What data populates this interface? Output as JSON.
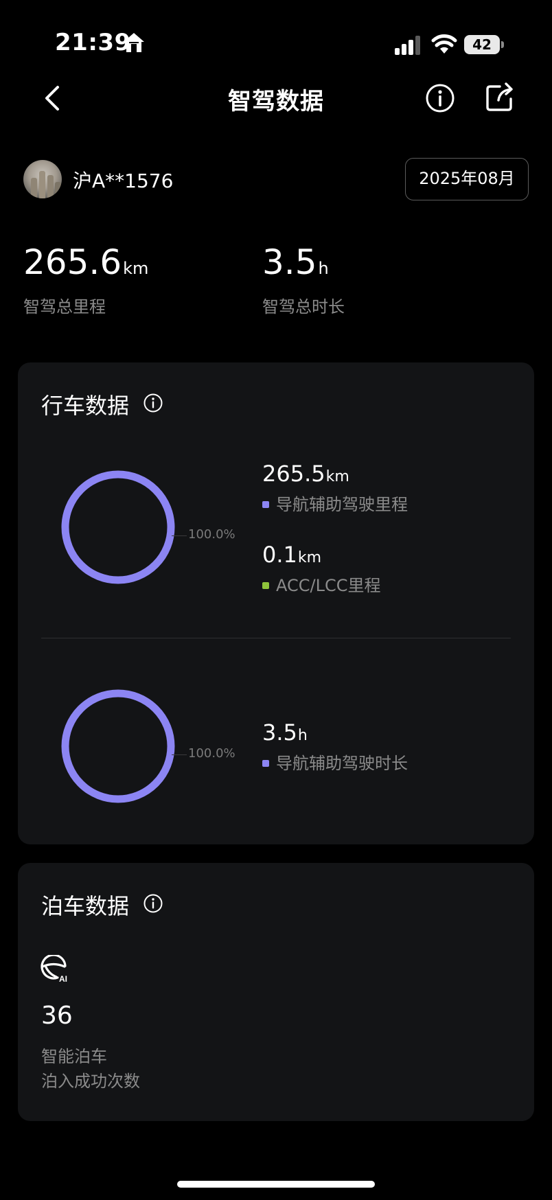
{
  "status_bar": {
    "time": "21:39",
    "battery": "42"
  },
  "nav": {
    "title": "智驾数据"
  },
  "user": {
    "plate": "沪A**1576",
    "month": "2025年08月"
  },
  "totals": {
    "distance": {
      "value": "265.6",
      "unit": "km",
      "caption": "智驾总里程"
    },
    "duration": {
      "value": "3.5",
      "unit": "h",
      "caption": "智驾总时长"
    }
  },
  "driving": {
    "title": "行车数据",
    "distance_chart": {
      "percent_label": "100.0%",
      "items": [
        {
          "value": "265.5",
          "unit": "km",
          "label": "导航辅助驾驶里程",
          "color": "#8c85f3"
        },
        {
          "value": "0.1",
          "unit": "km",
          "label": "ACC/LCC里程",
          "color": "#8fc43b"
        }
      ]
    },
    "duration_chart": {
      "percent_label": "100.0%",
      "items": [
        {
          "value": "3.5",
          "unit": "h",
          "label": "导航辅助驾驶时长",
          "color": "#8c85f3"
        }
      ]
    }
  },
  "parking": {
    "title": "泊车数据",
    "icon": "steering-wheel-ai-icon",
    "count": "36",
    "caption_line1": "智能泊车",
    "caption_line2": "泊入成功次数"
  },
  "colors": {
    "ring": "#8c85f3",
    "acc": "#8fc43b",
    "card_bg": "#131416"
  }
}
